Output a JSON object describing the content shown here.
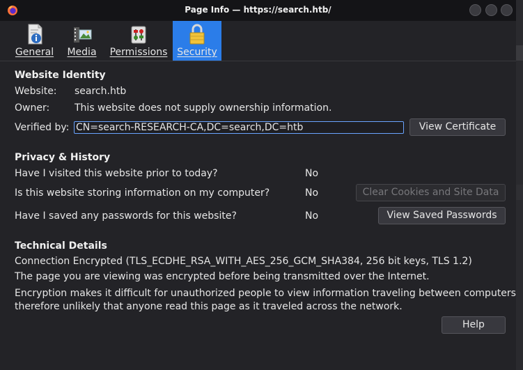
{
  "window": {
    "title": "Page Info — https://search.htb/"
  },
  "tabs": [
    {
      "label": "General",
      "icon": "info-icon",
      "active": false
    },
    {
      "label": "Media",
      "icon": "media-icon",
      "active": false
    },
    {
      "label": "Permissions",
      "icon": "permissions-icon",
      "active": false
    },
    {
      "label": "Security",
      "icon": "lock-icon",
      "active": true
    }
  ],
  "identity": {
    "heading": "Website Identity",
    "website_label": "Website:",
    "website_value": "search.htb",
    "owner_label": "Owner:",
    "owner_value": "This website does not supply ownership information.",
    "verified_label": "Verified by:",
    "verified_value": "CN=search-RESEARCH-CA,DC=search,DC=htb",
    "view_certificate": "View Certificate"
  },
  "privacy": {
    "heading": "Privacy & History",
    "q1": "Have I visited this website prior to today?",
    "a1": "No",
    "q2": "Is this website storing information on my computer?",
    "a2": "No",
    "clear_button": "Clear Cookies and Site Data",
    "q3": "Have I saved any passwords for this website?",
    "a3": "No",
    "passwords_button": "View Saved Passwords"
  },
  "technical": {
    "heading": "Technical Details",
    "line1": "Connection Encrypted (TLS_ECDHE_RSA_WITH_AES_256_GCM_SHA384, 256 bit keys, TLS 1.2)",
    "line2": "The page you are viewing was encrypted before being transmitted over the Internet.",
    "line3": "Encryption makes it difficult for unauthorized people to view information traveling between computers. It is",
    "line4": "therefore unlikely that anyone read this page as it traveled across the network."
  },
  "help_button": "Help",
  "colors": {
    "accent": "#2b7de9",
    "background": "#232327"
  }
}
